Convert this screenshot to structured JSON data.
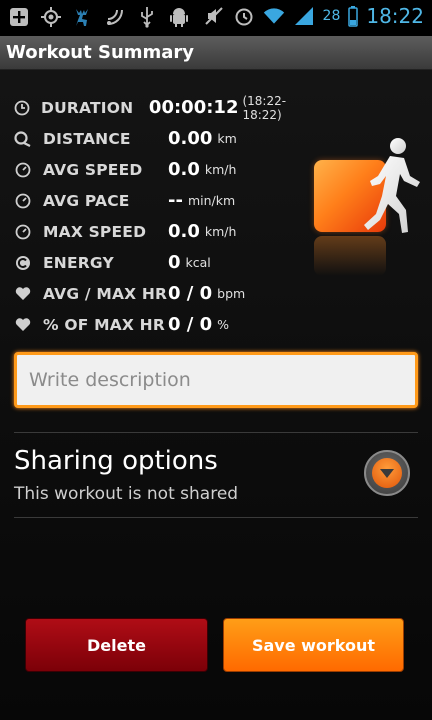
{
  "status_bar": {
    "icons": [
      "add-icon",
      "gps-icon",
      "deer-icon",
      "swirl-icon",
      "usb-icon",
      "android-icon",
      "mute-icon",
      "alarm-icon",
      "wifi-icon",
      "signal-icon"
    ],
    "battery": "28",
    "time": "18:22"
  },
  "title": "Workout Summary",
  "stats": [
    {
      "icon": "clock-icon",
      "label": "DURATION",
      "value": "00:00:12",
      "unit": "",
      "extra": "(18:22-18:22)"
    },
    {
      "icon": "distance-icon",
      "label": "DISTANCE",
      "value": "0.00",
      "unit": "km",
      "extra": ""
    },
    {
      "icon": "speed-icon",
      "label": "AVG SPEED",
      "value": "0.0",
      "unit": "km/h",
      "extra": ""
    },
    {
      "icon": "pace-icon",
      "label": "AVG PACE",
      "value": "--",
      "unit": "min/km",
      "extra": ""
    },
    {
      "icon": "max-speed-icon",
      "label": "MAX SPEED",
      "value": "0.0",
      "unit": "km/h",
      "extra": ""
    },
    {
      "icon": "energy-icon",
      "label": "ENERGY",
      "value": "0",
      "unit": "kcal",
      "extra": ""
    },
    {
      "icon": "heart-icon",
      "label": "AVG / MAX HR",
      "value": "0 / 0",
      "unit": "bpm",
      "extra": ""
    },
    {
      "icon": "heart-icon",
      "label": "% OF MAX HR",
      "value": "0 / 0",
      "unit": "%",
      "extra": ""
    }
  ],
  "description": {
    "placeholder": "Write description",
    "value": ""
  },
  "sharing": {
    "title": "Sharing options",
    "subtitle": "This workout is not shared"
  },
  "buttons": {
    "delete": "Delete",
    "save": "Save workout"
  },
  "colors": {
    "accent_orange": "#ff8a1a",
    "delete_red": "#a00a12",
    "time_blue": "#4fb7e6"
  }
}
